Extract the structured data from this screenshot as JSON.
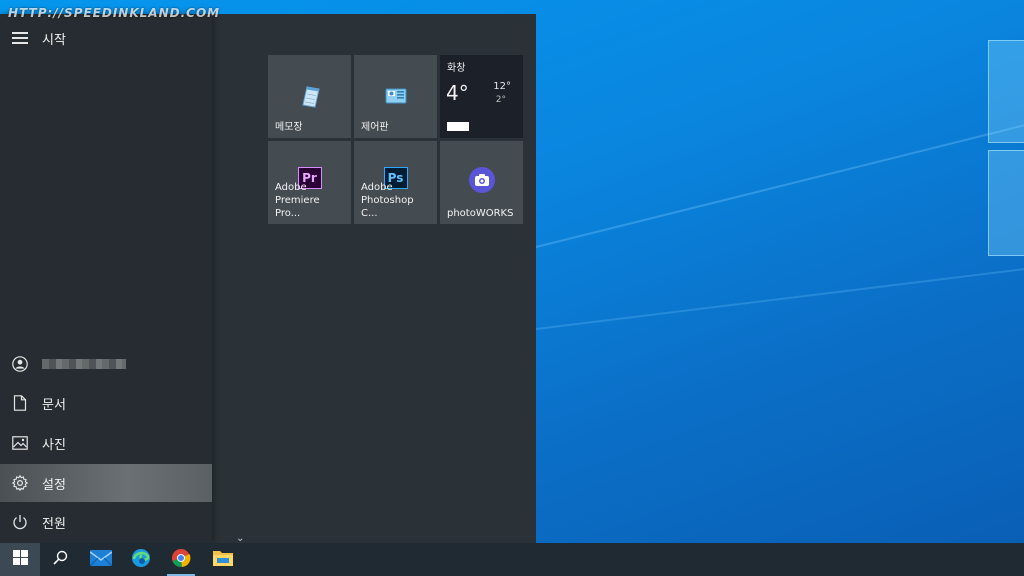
{
  "watermark": "HTTP://SPEEDINKLAND.COM",
  "start_menu": {
    "title": "시작",
    "rail_items": [
      {
        "label": "문서",
        "icon": "document-icon"
      },
      {
        "label": "사진",
        "icon": "pictures-icon"
      },
      {
        "label": "설정",
        "icon": "settings-gear-icon",
        "active": true
      },
      {
        "label": "전원",
        "icon": "power-icon"
      }
    ],
    "user": {
      "icon": "user-avatar-icon"
    }
  },
  "tiles": {
    "notepad": {
      "label": "메모장",
      "icon": "notepad-icon"
    },
    "control_panel": {
      "label": "제어판",
      "icon": "control-panel-icon"
    },
    "weather": {
      "title": "화창",
      "temp": "4°",
      "high": "12°",
      "low": "2°"
    },
    "premiere": {
      "label": "Adobe Premiere Pro...",
      "line1": "Adobe",
      "line2": "Premiere Pro...",
      "icon_text": "Pr"
    },
    "photoshop": {
      "label": "Adobe Photoshop C...",
      "line1": "Adobe",
      "line2": "Photoshop C...",
      "icon_text": "Ps"
    },
    "photoworks": {
      "label": "photoWORKS",
      "icon": "camera-icon"
    }
  },
  "taskbar": {
    "items": [
      "windows-start-icon",
      "search-icon",
      "mail-icon",
      "edge-icon",
      "chrome-icon",
      "file-explorer-icon"
    ]
  },
  "colors": {
    "accent": "#0a86df",
    "menu_bg": "#2b3237",
    "rail_bg": "#262c31",
    "tile_bg": "#454c51",
    "taskbar_bg": "#1f2a33"
  }
}
